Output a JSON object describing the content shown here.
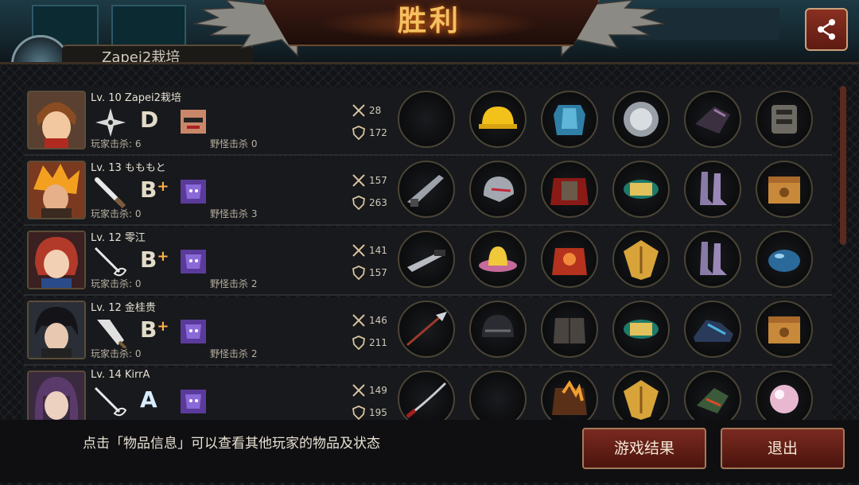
{
  "header": {
    "title": "胜利",
    "partial_label": "Zapei2栽培"
  },
  "players": [
    {
      "level_name": "Lv. 10 Zapei2栽培",
      "rank": "D",
      "rank_plus": "",
      "player_kills": "玩家击杀: 6",
      "monster_kills": "野怪击杀 0",
      "attack": "28",
      "defense": "172",
      "role_icon": "shuriken-icon",
      "items": [
        "empty-slot",
        "yellow-hardhat-icon",
        "blue-armor-icon",
        "steel-disc-icon",
        "dark-gauntlet-icon",
        "mech-armor-icon"
      ]
    },
    {
      "level_name": "Lv. 13 もももと",
      "rank": "B",
      "rank_plus": "+",
      "player_kills": "玩家击杀: 0",
      "monster_kills": "野怪击杀 3",
      "attack": "157",
      "defense": "263",
      "role_icon": "baton-icon",
      "items": [
        "dagger-icon",
        "armored-helm-icon",
        "red-cape-armor-icon",
        "gold-bracer-icon",
        "purple-boots-icon",
        "treasure-box-icon"
      ]
    },
    {
      "level_name": "Lv. 12 零江",
      "rank": "B",
      "rank_plus": "+",
      "player_kills": "玩家击杀: 0",
      "monster_kills": "野怪击杀 2",
      "attack": "141",
      "defense": "157",
      "role_icon": "rapier-icon",
      "items": [
        "combat-knife-icon",
        "pink-hat-icon",
        "red-robe-icon",
        "gold-shield-icon",
        "purple-boots-icon",
        "blue-orb-icon"
      ]
    },
    {
      "level_name": "Lv. 12 金桂贵",
      "rank": "B",
      "rank_plus": "+",
      "player_kills": "玩家击杀: 0",
      "monster_kills": "野怪击杀 2",
      "attack": "146",
      "defense": "211",
      "role_icon": "cleaver-icon",
      "items": [
        "spear-icon",
        "dark-helmet-icon",
        "leather-armor-icon",
        "gold-bracer-icon",
        "sneaker-icon",
        "treasure-box-icon"
      ]
    },
    {
      "level_name": "Lv. 14 KirrA",
      "rank": "A",
      "rank_plus": "",
      "player_kills": "",
      "monster_kills": "",
      "attack": "149",
      "defense": "195",
      "role_icon": "rapier-icon",
      "items": [
        "katana-icon",
        "empty-slot",
        "fire-armor-icon",
        "gold-shield-icon",
        "green-gauntlet-icon",
        "pearl-icon"
      ]
    }
  ],
  "footer": {
    "hint": "点击「物品信息」可以查看其他玩家的物品及状态",
    "result_button": "游戏结果",
    "exit_button": "退出"
  },
  "colors": {
    "title": "#f4c060",
    "button_bg": "#7a2a20",
    "plus_sign": "#ffb24a"
  }
}
